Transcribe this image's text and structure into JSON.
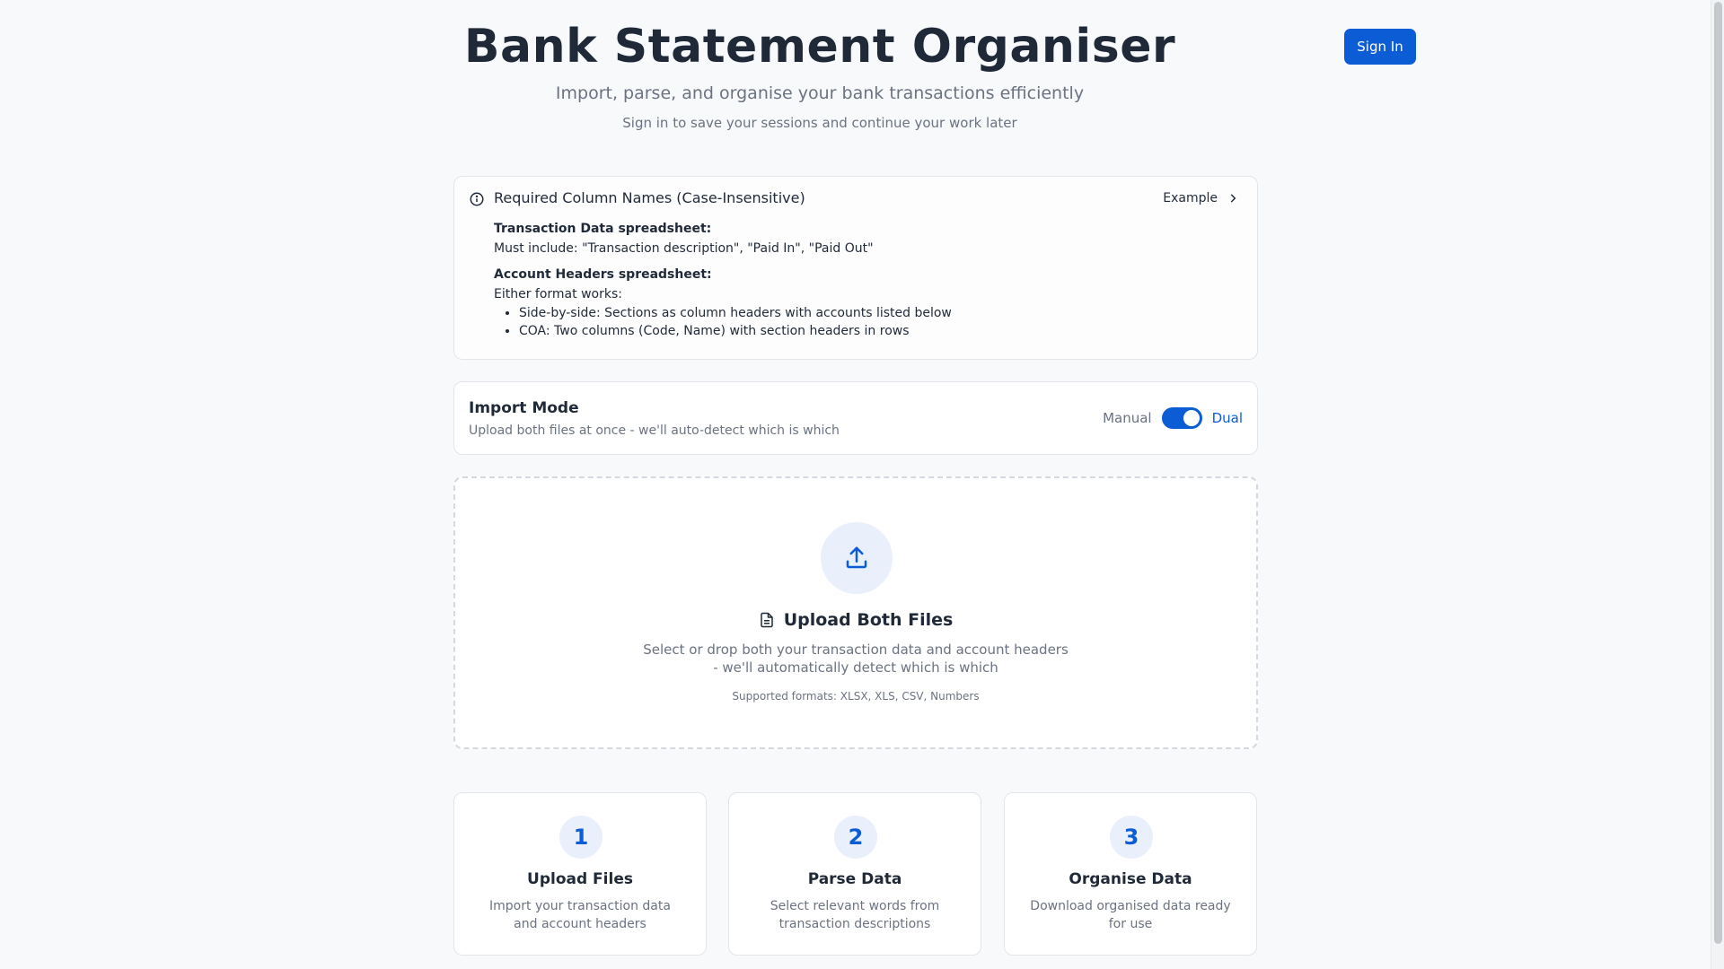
{
  "header": {
    "title": "Bank Statement Organiser",
    "subtitle": "Import, parse, and organise your bank transactions efficiently",
    "hint": "Sign in to save your sessions and continue your work later",
    "signin_label": "Sign In"
  },
  "requirements": {
    "title": "Required Column Names (Case-Insensitive)",
    "example_label": "Example",
    "transaction_label": "Transaction Data spreadsheet:",
    "transaction_text": "Must include: \"Transaction description\", \"Paid In\", \"Paid Out\"",
    "account_label": "Account Headers spreadsheet:",
    "account_text": "Either format works:",
    "formats": [
      "Side-by-side: Sections as column headers with accounts listed below",
      "COA: Two columns (Code, Name) with section headers in rows"
    ]
  },
  "import_mode": {
    "title": "Import Mode",
    "description": "Upload both files at once - we'll auto-detect which is which",
    "manual_label": "Manual",
    "dual_label": "Dual",
    "selected": "Dual"
  },
  "upload": {
    "title": "Upload Both Files",
    "description_line1": "Select or drop both your transaction data and account headers",
    "description_line2": "- we'll automatically detect which is which",
    "formats": "Supported formats: XLSX, XLS, CSV, Numbers"
  },
  "steps": [
    {
      "number": "1",
      "title": "Upload Files",
      "line1": "Import your transaction data",
      "line2": "and account headers"
    },
    {
      "number": "2",
      "title": "Parse Data",
      "line1": "Select relevant words from",
      "line2": "transaction descriptions"
    },
    {
      "number": "3",
      "title": "Organise Data",
      "line1": "Download organised data ready",
      "line2": "for use"
    }
  ],
  "colors": {
    "accent": "#0b5cd5",
    "accent_light": "#e9effb",
    "background": "#f7f9fb",
    "text": "#1f2937",
    "muted": "#6b7280"
  },
  "icons": {
    "info": "info-icon",
    "example_chevron": "chevron-right-icon",
    "upload": "upload-icon",
    "file": "file-icon"
  }
}
